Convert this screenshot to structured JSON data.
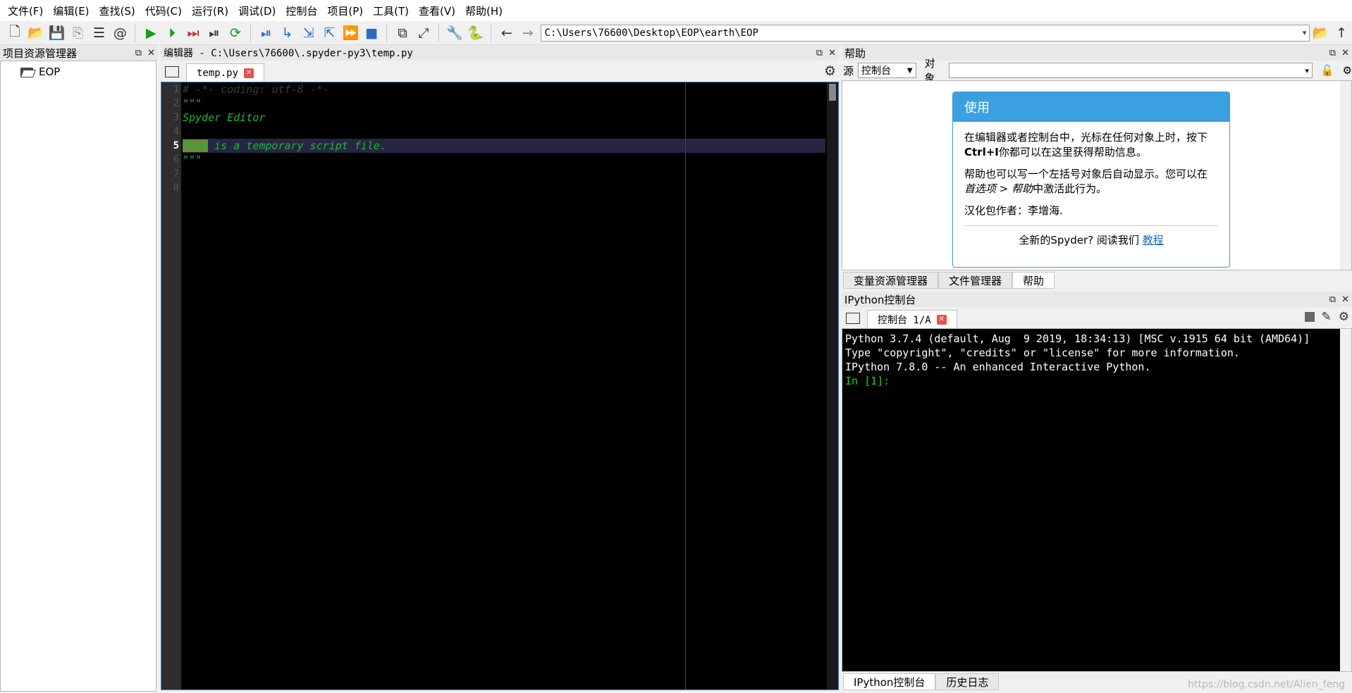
{
  "menu": [
    "文件(F)",
    "编辑(E)",
    "查找(S)",
    "代码(C)",
    "运行(R)",
    "调试(D)",
    "控制台",
    "项目(P)",
    "工具(T)",
    "查看(V)",
    "帮助(H)"
  ],
  "toolbar": {
    "path": "C:\\Users\\76600\\Desktop\\EOP\\earth\\EOP",
    "icons": [
      "new-file",
      "open-file",
      "save",
      "save-all",
      "outline",
      "at-sign",
      "run",
      "run-cell",
      "run-cell-advance",
      "run-selection",
      "rerun",
      "debug",
      "step",
      "step-into",
      "step-return",
      "continue",
      "stop",
      "maximize-pane",
      "fullscreen",
      "preferences",
      "python-path",
      "back",
      "forward",
      "browse-folder",
      "parent-dir"
    ]
  },
  "project": {
    "title": "项目资源管理器",
    "items": [
      "EOP"
    ]
  },
  "editor": {
    "title": "编辑器 - C:\\Users\\76600\\.spyder-py3\\temp.py",
    "tab": "temp.py",
    "line_numbers": [
      "1",
      "2",
      "3",
      "4",
      "5",
      "6",
      "7",
      "8"
    ],
    "active_line": "5",
    "lines": [
      "# -*- coding: utf-8 -*-",
      "\"\"\"",
      "Spyder Editor",
      "",
      "This is a temporary script file.",
      "\"\"\"",
      "",
      ""
    ],
    "highlighted_word": "This",
    "rest_of_line5": " is a temporary script file."
  },
  "help": {
    "title": "帮助",
    "source_label": "源",
    "source_value": "控制台",
    "object_label": "对象",
    "object_value": "",
    "card_title": "使用",
    "p1a": "在编辑器或者控制台中，光标在任何对象上时，按下",
    "p1_key": "Ctrl+I",
    "p1b": "你都可以在这里获得帮助信息。",
    "p2a": "帮助也可以写一个左括号对象后自动显示。您可以在",
    "p2_em": "首选项 > 帮助",
    "p2b": "中激活此行为。",
    "p3": "汉化包作者：李增海.",
    "foot_text": "全新的Spyder? 阅读我们 ",
    "foot_link": "教程",
    "tabs": [
      "变量资源管理器",
      "文件管理器",
      "帮助"
    ],
    "active_tab": "帮助"
  },
  "console": {
    "title": "IPython控制台",
    "tab": "控制台 1/A",
    "lines": [
      "Python 3.7.4 (default, Aug  9 2019, 18:34:13) [MSC v.1915 64 bit (AMD64)]",
      "Type \"copyright\", \"credits\" or \"license\" for more information.",
      "",
      "IPython 7.8.0 -- An enhanced Interactive Python.",
      ""
    ],
    "prompt": "In [1]:",
    "tabs": [
      "IPython控制台",
      "历史日志"
    ],
    "active_tab": "IPython控制台"
  },
  "watermark": "https://blog.csdn.net/Alien_feng"
}
